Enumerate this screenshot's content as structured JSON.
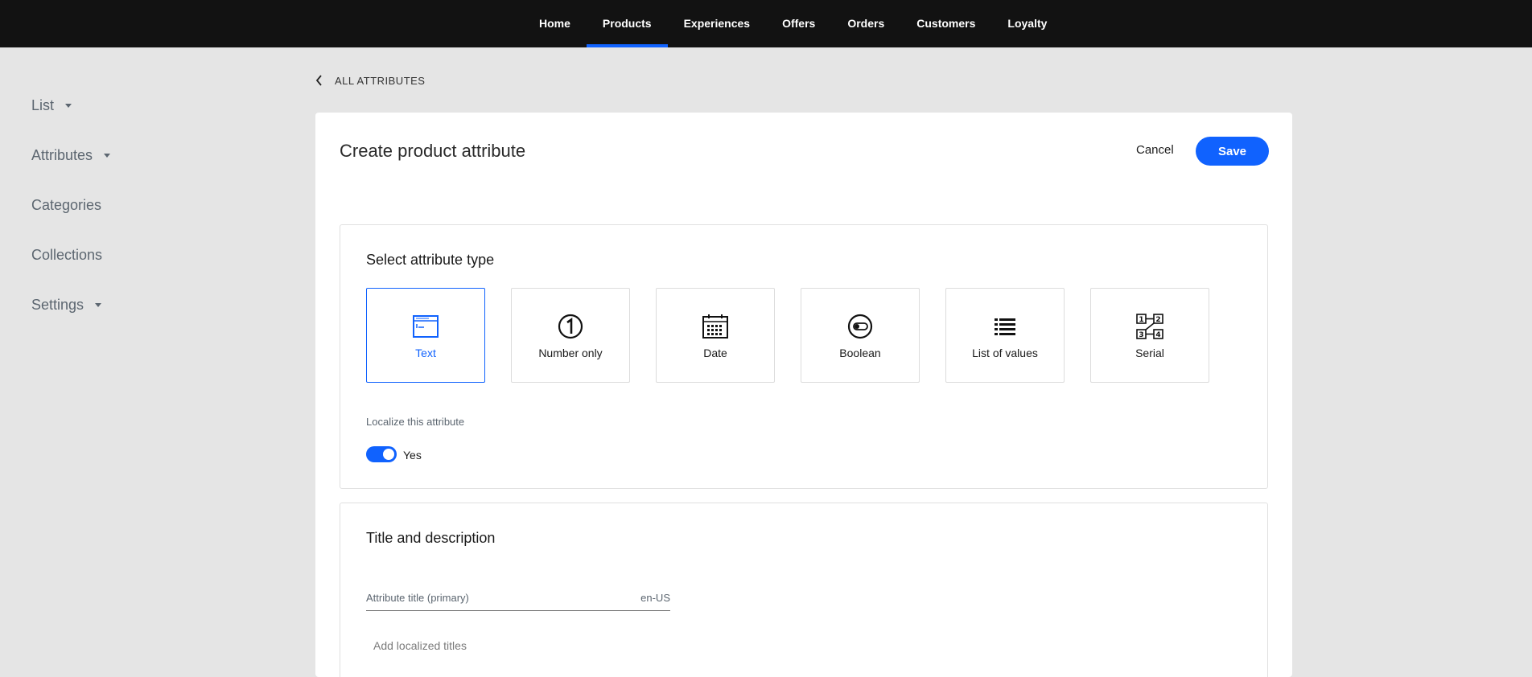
{
  "topnav": {
    "items": [
      {
        "label": "Home"
      },
      {
        "label": "Products"
      },
      {
        "label": "Experiences"
      },
      {
        "label": "Offers"
      },
      {
        "label": "Orders"
      },
      {
        "label": "Customers"
      },
      {
        "label": "Loyalty"
      }
    ],
    "active": "Products",
    "accent_color": "#1062fe"
  },
  "sidebar": {
    "items": [
      {
        "label": "List",
        "has_dropdown": true
      },
      {
        "label": "Attributes",
        "has_dropdown": true
      },
      {
        "label": "Categories",
        "has_dropdown": false
      },
      {
        "label": "Collections",
        "has_dropdown": false
      },
      {
        "label": "Settings",
        "has_dropdown": true
      }
    ]
  },
  "back_link": {
    "label": "ALL ATTRIBUTES",
    "icon": "chevron-left-icon"
  },
  "page": {
    "title": "Create product attribute",
    "cancel_label": "Cancel",
    "save_label": "Save"
  },
  "attribute_type": {
    "heading": "Select attribute type",
    "types": [
      {
        "label": "Text",
        "icon": "text-field-icon",
        "selected": true
      },
      {
        "label": "Number only",
        "icon": "number-circle-icon",
        "selected": false
      },
      {
        "label": "Date",
        "icon": "calendar-icon",
        "selected": false
      },
      {
        "label": "Boolean",
        "icon": "toggle-icon",
        "selected": false
      },
      {
        "label": "List of values",
        "icon": "list-icon",
        "selected": false
      },
      {
        "label": "Serial",
        "icon": "serial-icon",
        "selected": false
      }
    ],
    "localize_label": "Localize this attribute",
    "localize_value": "Yes",
    "localize_on": true
  },
  "title_description": {
    "heading": "Title and description",
    "title_field_label": "Attribute title (primary)",
    "title_field_locale": "en-US",
    "add_localized_label": "Add localized titles"
  }
}
